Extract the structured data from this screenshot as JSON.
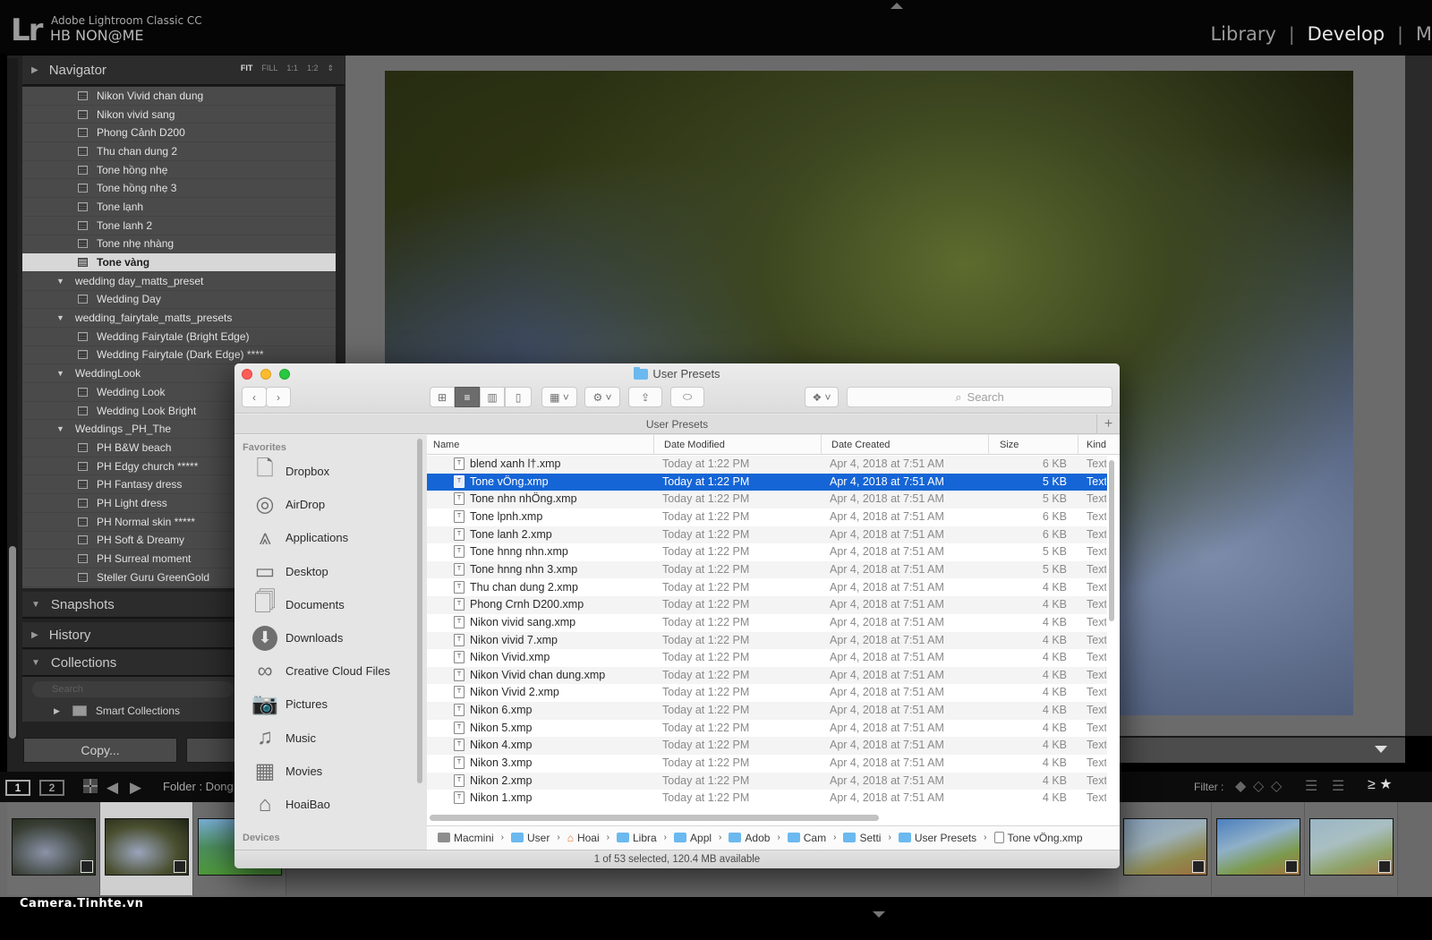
{
  "app": {
    "logo": "Lr",
    "title": "Adobe Lightroom Classic CC",
    "identity_plate": "HB NON@ME",
    "modules": [
      "Library",
      "Develop",
      "M"
    ],
    "active_module": "Develop"
  },
  "left_panel": {
    "navigator": {
      "label": "Navigator",
      "zoom_options": [
        "FIT",
        "FILL",
        "1:1",
        "1:2"
      ],
      "active_zoom": "FIT"
    },
    "presets": [
      {
        "type": "item",
        "label": "Nikon Vivid chan dung"
      },
      {
        "type": "item",
        "label": "Nikon vivid sang"
      },
      {
        "type": "item",
        "label": "Phong Cảnh D200"
      },
      {
        "type": "item",
        "label": "Thu chan dung 2"
      },
      {
        "type": "item",
        "label": "Tone hồng nhẹ"
      },
      {
        "type": "item",
        "label": "Tone hồng nhẹ 3"
      },
      {
        "type": "item",
        "label": "Tone lạnh"
      },
      {
        "type": "item",
        "label": "Tone lanh 2"
      },
      {
        "type": "item",
        "label": "Tone nhẹ nhàng"
      },
      {
        "type": "item",
        "label": "Tone vàng",
        "selected": true
      },
      {
        "type": "folder",
        "label": "wedding day_matts_preset"
      },
      {
        "type": "item",
        "label": "Wedding Day"
      },
      {
        "type": "folder",
        "label": "wedding_fairytale_matts_presets"
      },
      {
        "type": "item",
        "label": "Wedding Fairytale (Bright Edge)"
      },
      {
        "type": "item",
        "label": "Wedding Fairytale (Dark Edge) ****"
      },
      {
        "type": "folder",
        "label": "WeddingLook"
      },
      {
        "type": "item",
        "label": "Wedding Look"
      },
      {
        "type": "item",
        "label": "Wedding Look Bright"
      },
      {
        "type": "folder",
        "label": "Weddings _PH_The"
      },
      {
        "type": "item",
        "label": "PH B&W beach"
      },
      {
        "type": "item",
        "label": "PH Edgy church *****"
      },
      {
        "type": "item",
        "label": "PH Fantasy dress"
      },
      {
        "type": "item",
        "label": "PH Light dress"
      },
      {
        "type": "item",
        "label": "PH Normal skin *****"
      },
      {
        "type": "item",
        "label": "PH Soft & Dreamy"
      },
      {
        "type": "item",
        "label": "PH Surreal moment"
      },
      {
        "type": "item",
        "label": "Steller Guru GreenGold"
      }
    ],
    "snapshots_label": "Snapshots",
    "history_label": "History",
    "collections_label": "Collections",
    "collections_search_placeholder": "Search",
    "smart_collections_label": "Smart Collections",
    "copy_button": "Copy..."
  },
  "filmstrip_bar": {
    "view1": "1",
    "view2": "2",
    "folder_label": "Folder : Dong",
    "filter_label": "Filter :",
    "rating_filter": "≥ ★"
  },
  "watermark": "Camera.Tinhte.vn",
  "finder": {
    "title": "User Presets",
    "path_header": "User Presets",
    "search_placeholder": "Search",
    "sidebar": {
      "favorites_heading": "Favorites",
      "devices_heading": "Devices",
      "items": [
        {
          "label": "Dropbox",
          "icon": "dropbox-folder-icon"
        },
        {
          "label": "AirDrop",
          "icon": "airdrop-icon"
        },
        {
          "label": "Applications",
          "icon": "applications-icon"
        },
        {
          "label": "Desktop",
          "icon": "desktop-icon"
        },
        {
          "label": "Documents",
          "icon": "documents-icon"
        },
        {
          "label": "Downloads",
          "icon": "downloads-icon"
        },
        {
          "label": "Creative Cloud Files",
          "icon": "creative-cloud-icon"
        },
        {
          "label": "Pictures",
          "icon": "camera-icon"
        },
        {
          "label": "Music",
          "icon": "music-note-icon"
        },
        {
          "label": "Movies",
          "icon": "film-icon"
        },
        {
          "label": "HoaiBao",
          "icon": "home-icon"
        }
      ]
    },
    "columns": [
      "Name",
      "Date Modified",
      "Date Created",
      "Size",
      "Kind"
    ],
    "files": [
      {
        "name": "blend xanh l†.xmp",
        "modified": "Today at 1:22 PM",
        "created": "Apr 4, 2018 at 7:51 AM",
        "size": "6 KB",
        "kind": "Text"
      },
      {
        "name": "Tone vÖng.xmp",
        "modified": "Today at 1:22 PM",
        "created": "Apr 4, 2018 at 7:51 AM",
        "size": "5 KB",
        "kind": "Text",
        "selected": true
      },
      {
        "name": "Tone nhn nhÖng.xmp",
        "modified": "Today at 1:22 PM",
        "created": "Apr 4, 2018 at 7:51 AM",
        "size": "5 KB",
        "kind": "Text"
      },
      {
        "name": "Tone lpnh.xmp",
        "modified": "Today at 1:22 PM",
        "created": "Apr 4, 2018 at 7:51 AM",
        "size": "6 KB",
        "kind": "Text"
      },
      {
        "name": "Tone lanh 2.xmp",
        "modified": "Today at 1:22 PM",
        "created": "Apr 4, 2018 at 7:51 AM",
        "size": "6 KB",
        "kind": "Text"
      },
      {
        "name": "Tone hnng nhn.xmp",
        "modified": "Today at 1:22 PM",
        "created": "Apr 4, 2018 at 7:51 AM",
        "size": "5 KB",
        "kind": "Text"
      },
      {
        "name": "Tone hnng nhn 3.xmp",
        "modified": "Today at 1:22 PM",
        "created": "Apr 4, 2018 at 7:51 AM",
        "size": "5 KB",
        "kind": "Text"
      },
      {
        "name": "Thu chan dung 2.xmp",
        "modified": "Today at 1:22 PM",
        "created": "Apr 4, 2018 at 7:51 AM",
        "size": "4 KB",
        "kind": "Text"
      },
      {
        "name": "Phong Crnh D200.xmp",
        "modified": "Today at 1:22 PM",
        "created": "Apr 4, 2018 at 7:51 AM",
        "size": "4 KB",
        "kind": "Text"
      },
      {
        "name": "Nikon vivid sang.xmp",
        "modified": "Today at 1:22 PM",
        "created": "Apr 4, 2018 at 7:51 AM",
        "size": "4 KB",
        "kind": "Text"
      },
      {
        "name": "Nikon vivid 7.xmp",
        "modified": "Today at 1:22 PM",
        "created": "Apr 4, 2018 at 7:51 AM",
        "size": "4 KB",
        "kind": "Text"
      },
      {
        "name": "Nikon Vivid.xmp",
        "modified": "Today at 1:22 PM",
        "created": "Apr 4, 2018 at 7:51 AM",
        "size": "4 KB",
        "kind": "Text"
      },
      {
        "name": "Nikon Vivid chan dung.xmp",
        "modified": "Today at 1:22 PM",
        "created": "Apr 4, 2018 at 7:51 AM",
        "size": "4 KB",
        "kind": "Text"
      },
      {
        "name": "Nikon Vivid 2.xmp",
        "modified": "Today at 1:22 PM",
        "created": "Apr 4, 2018 at 7:51 AM",
        "size": "4 KB",
        "kind": "Text"
      },
      {
        "name": "Nikon 6.xmp",
        "modified": "Today at 1:22 PM",
        "created": "Apr 4, 2018 at 7:51 AM",
        "size": "4 KB",
        "kind": "Text"
      },
      {
        "name": "Nikon 5.xmp",
        "modified": "Today at 1:22 PM",
        "created": "Apr 4, 2018 at 7:51 AM",
        "size": "4 KB",
        "kind": "Text"
      },
      {
        "name": "Nikon 4.xmp",
        "modified": "Today at 1:22 PM",
        "created": "Apr 4, 2018 at 7:51 AM",
        "size": "4 KB",
        "kind": "Text"
      },
      {
        "name": "Nikon 3.xmp",
        "modified": "Today at 1:22 PM",
        "created": "Apr 4, 2018 at 7:51 AM",
        "size": "4 KB",
        "kind": "Text"
      },
      {
        "name": "Nikon 2.xmp",
        "modified": "Today at 1:22 PM",
        "created": "Apr 4, 2018 at 7:51 AM",
        "size": "4 KB",
        "kind": "Text"
      },
      {
        "name": "Nikon 1.xmp",
        "modified": "Today at 1:22 PM",
        "created": "Apr 4, 2018 at 7:51 AM",
        "size": "4 KB",
        "kind": "Text"
      }
    ],
    "path": [
      {
        "label": "Macmini",
        "icon": "disk"
      },
      {
        "label": "User",
        "icon": "folder"
      },
      {
        "label": "Hoai",
        "icon": "home"
      },
      {
        "label": "Libra",
        "icon": "folder"
      },
      {
        "label": "Appl",
        "icon": "folder"
      },
      {
        "label": "Adob",
        "icon": "folder"
      },
      {
        "label": "Cam",
        "icon": "folder"
      },
      {
        "label": "Setti",
        "icon": "folder"
      },
      {
        "label": "User Presets",
        "icon": "folder"
      },
      {
        "label": "Tone vÖng.xmp",
        "icon": "file"
      }
    ],
    "status": "1 of 53 selected, 120.4 MB available"
  },
  "colors": {
    "selection_blue": "#1565d6",
    "folder_blue": "#6bb9ef",
    "lr_panel": "#4a4a4a"
  }
}
